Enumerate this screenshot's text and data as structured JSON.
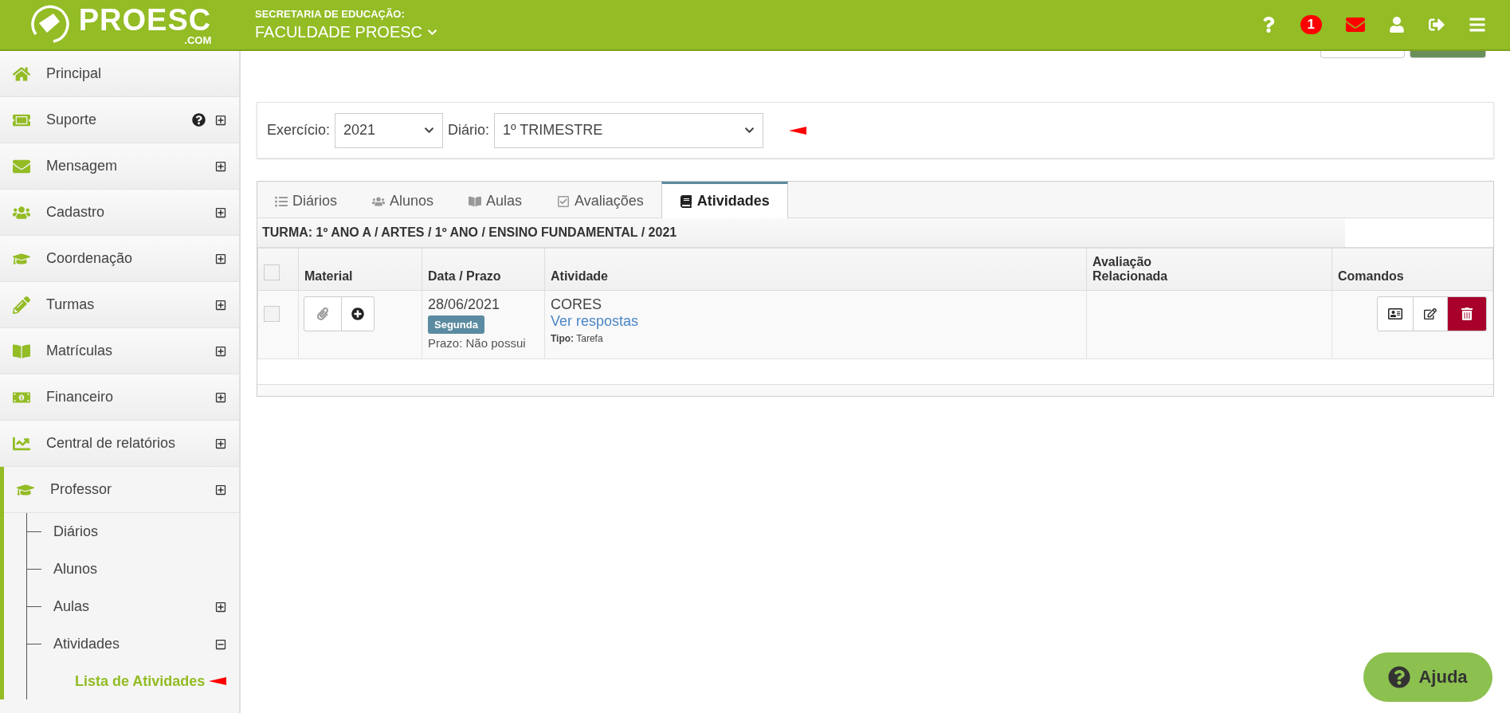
{
  "header": {
    "logo_text": "PROESC",
    "logo_sub": ".COM",
    "secretaria_label": "SECRETARIA DE EDUCAÇÃO:",
    "institution": "FACULDADE PROESC",
    "notification_count": "1"
  },
  "sidebar": {
    "items": [
      {
        "label": "Principal",
        "selected": false
      },
      {
        "label": "Suporte",
        "selected": false,
        "help": true,
        "expanded": false
      },
      {
        "label": "Mensagem",
        "selected": false,
        "expanded": false
      },
      {
        "label": "Cadastro",
        "selected": false,
        "expanded": false
      },
      {
        "label": "Coordenação",
        "selected": false,
        "expanded": false
      },
      {
        "label": "Turmas",
        "selected": false,
        "expanded": false
      },
      {
        "label": "Matrículas",
        "selected": false,
        "expanded": false
      },
      {
        "label": "Financeiro",
        "selected": false,
        "expanded": false
      },
      {
        "label": "Central de relatórios",
        "selected": false,
        "expanded": false
      },
      {
        "label": "Professor",
        "selected": true,
        "expanded": false,
        "children": [
          {
            "label": "Diários",
            "selected": false
          },
          {
            "label": "Alunos",
            "selected": false
          },
          {
            "label": "Aulas",
            "selected": false,
            "expanded": false
          },
          {
            "label": "Atividades",
            "selected": false,
            "expanded": true,
            "children": [
              {
                "label": "Lista de Atividades",
                "selected": true
              }
            ]
          }
        ]
      }
    ]
  },
  "filters": [
    {
      "label": "Exercício:",
      "value": "2021"
    },
    {
      "label": "Diário:",
      "value": "1º TRIMESTRE"
    }
  ],
  "tabs": [
    {
      "label": "Diários",
      "selected": false
    },
    {
      "label": "Alunos",
      "selected": false
    },
    {
      "label": "Aulas",
      "selected": false
    },
    {
      "label": "Avaliações",
      "selected": false
    },
    {
      "label": "Atividades",
      "selected": true
    }
  ],
  "turma": "TURMA: 1º ANO A / ARTES / 1º ANO / ENSINO FUNDAMENTAL / 2021",
  "table": {
    "all_checked": false,
    "columns": [
      "Material",
      "Data / Prazo",
      "Atividade",
      "Avaliação\nRelacionada",
      "Comandos"
    ],
    "rows": [
      {
        "checked": false,
        "date": "28/06/2021",
        "weekday": "Segunda",
        "deadline": "Prazo: Não possui",
        "activity": "CORES",
        "link": "Ver respostas",
        "type_label": "Tipo:",
        "type": "Tarefa"
      }
    ]
  },
  "help_button": "Ajuda"
}
